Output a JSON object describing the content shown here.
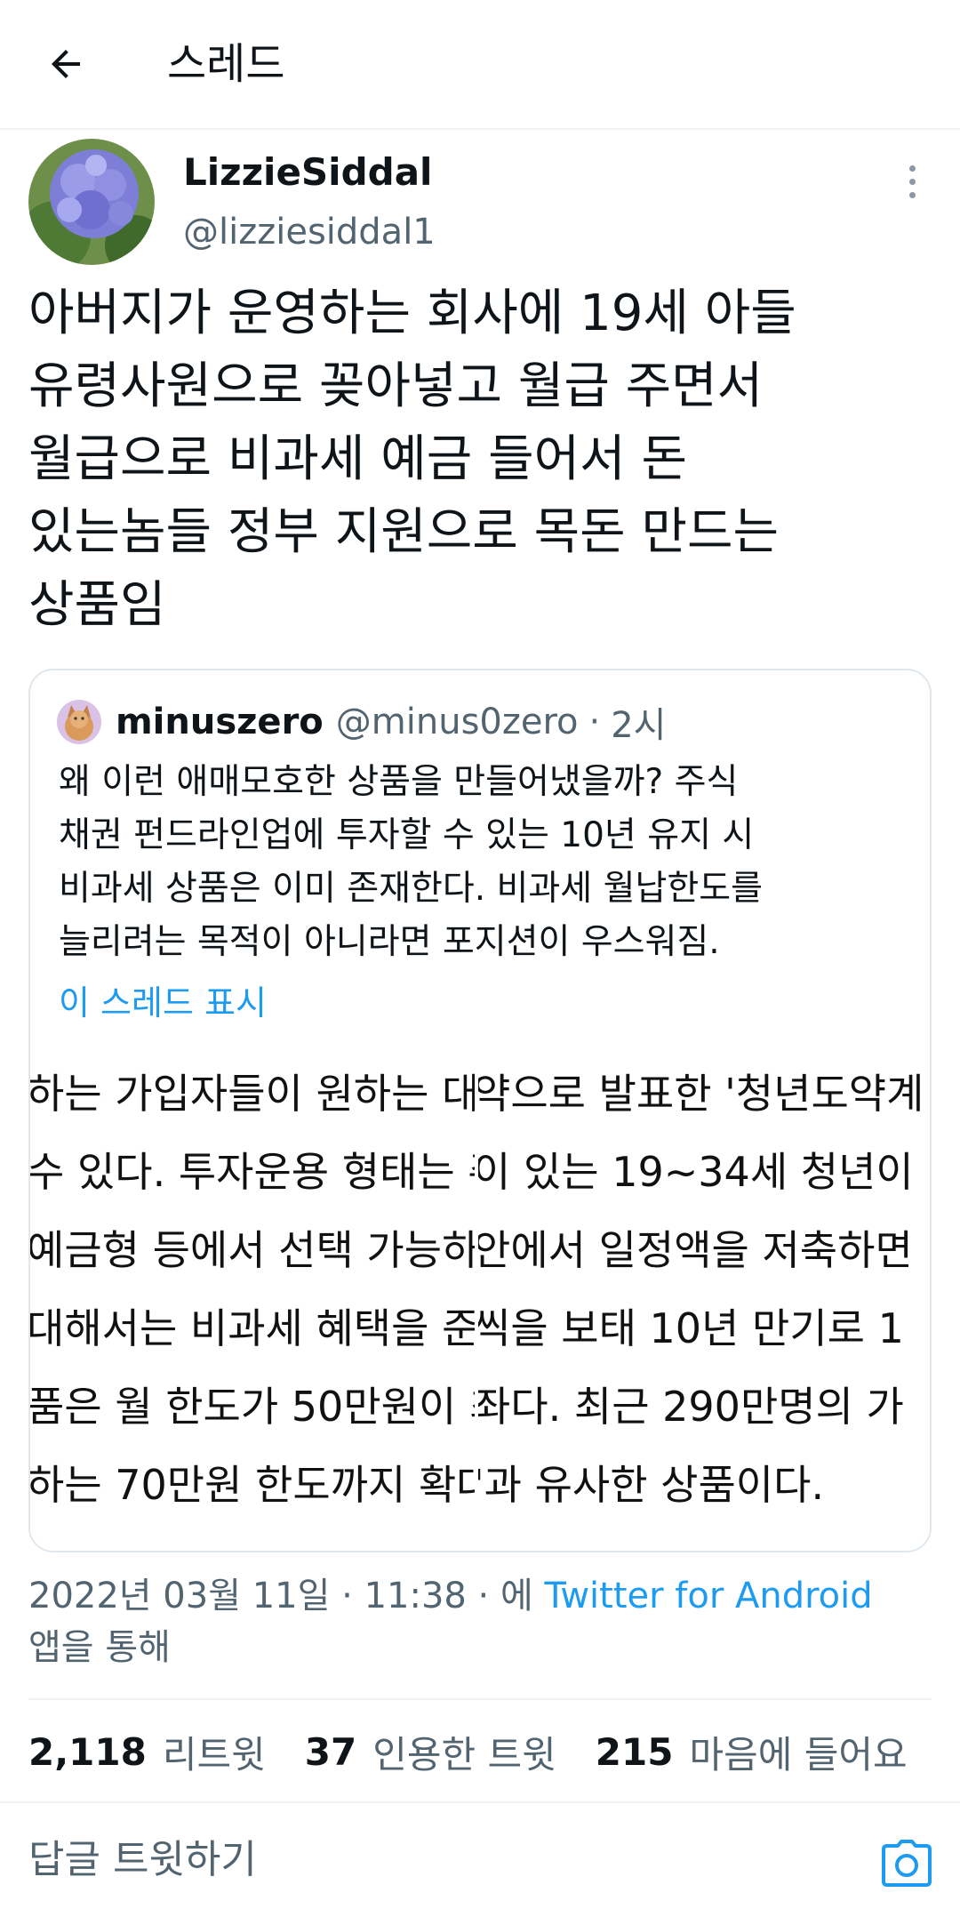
{
  "header": {
    "title": "스레드",
    "back_icon": "arrow-left-icon"
  },
  "author": {
    "display_name": "LizzieSiddal",
    "handle": "@lizziesiddal1",
    "avatar": "hydrangea-photo",
    "more_icon": "more-vertical-icon"
  },
  "tweet": {
    "text": "아버지가 운영하는 회사에 19세 아들\n유령사원으로 꽂아넣고 월급 주면서\n월급으로 비과세 예금 들어서 돈\n있는놈들 정부 지원으로 목돈 만드는\n상품임"
  },
  "quote": {
    "display_name": "minuszero",
    "handle": "@minus0zero",
    "separator": "·",
    "time": "2시",
    "text": "왜 이런 애매모호한 상품을 만들어냈을까? 주식\n채권 펀드라인업에 투자할 수 있는 10년 유지 시\n비과세 상품은 이미 존재한다. 비과세 월납한도를\n늘리려는 목적이 아니라면 포지션이 우스워짐.",
    "show_thread": "이 스레드 표시",
    "media": {
      "left_lines": [
        "하는 가입자들이 원하는 대로",
        "수 있다. 투자운용 형태는 주",
        "예금형 등에서 선택 가능하",
        "대해서는 비과세 혜택을 준다",
        "품은 월 한도가 50만원이 최",
        "하는 70만원 한도까지 확대된"
      ],
      "right_lines": [
        "약으로 발표한 '청년도약계",
        "이 있는 19~34세 청년이",
        "안에서 일정액을 저축하면",
        "씩을 보태 10년 만기로 1",
        "좌다. 최근 290만명의 가",
        "'과 유사한 상품이다."
      ]
    }
  },
  "meta": {
    "timestamp": "2022년 03월 11일 · 11:38 · 에 ",
    "source": "Twitter for Android",
    "suffix": "앱을 통해"
  },
  "stats": {
    "retweets": "2,118",
    "retweets_label": "리트윗",
    "quotes": "37",
    "quotes_label": "인용한 트윗",
    "likes": "215",
    "likes_label": "마음에 들어요"
  },
  "reply": {
    "placeholder": "답글 트윗하기",
    "camera_icon": "camera-icon"
  },
  "colors": {
    "link": "#1d9bf0",
    "secondary_text": "#536471",
    "border": "#e1e8ed"
  }
}
